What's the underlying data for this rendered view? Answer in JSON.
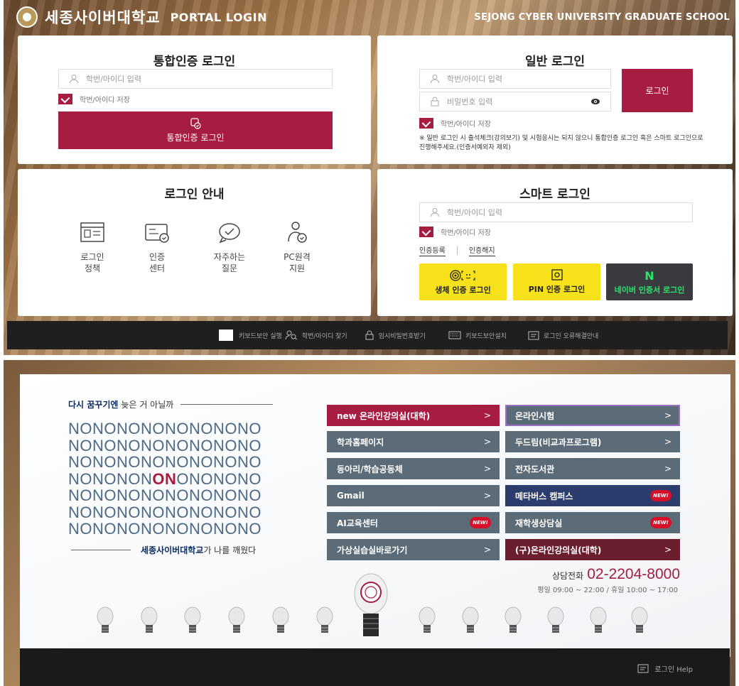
{
  "header": {
    "univ_name": "세종사이버대학교",
    "portal_label": "PORTAL LOGIN",
    "grad_school": "SEJONG CYBER UNIVERSITY GRADUATE SCHOOL"
  },
  "integrated_login": {
    "title": "통합인증 로그인",
    "id_placeholder": "학번/아이디 입력",
    "save_id": "학번/아이디 저장",
    "button": "통합인증 로그인"
  },
  "general_login": {
    "title": "일반 로그인",
    "id_placeholder": "학번/아이디 입력",
    "pw_placeholder": "비밀번호 입력",
    "button": "로그인",
    "save_id": "학번/아이디 저장",
    "notice": "※ 일반 로그인 시 출석체크(강의보기) 및 시험응시는 되지 않으니 통합인증 로그인 혹은 스마트 로그인으로 진행해주세요.(인증서예외자 제외)"
  },
  "login_guide": {
    "title": "로그인 안내",
    "items": [
      {
        "line1": "로그인",
        "line2": "정책"
      },
      {
        "line1": "인증",
        "line2": "센터"
      },
      {
        "line1": "자주하는",
        "line2": "질문"
      },
      {
        "line1": "PC원격",
        "line2": "지원"
      }
    ]
  },
  "smart_login": {
    "title": "스마트 로그인",
    "id_placeholder": "학번/아이디 입력",
    "save_id": "학번/아이디 저장",
    "register": "인증등록",
    "unregister": "인증해지",
    "bio_button": "생체 인증 로그인",
    "pin_button": "PIN 인증 로그인",
    "naver_button": "네이버 인증서 로그인",
    "naver_logo": "N"
  },
  "top_footer": {
    "keyboard_security_run": "키보드보안 실행",
    "find_id": "학번/아이디 찾기",
    "temp_password": "임시비밀번호받기",
    "keyboard_security_install": "키보드보안설치",
    "login_error_guide": "로그인 오류해결안내"
  },
  "promo": {
    "slogan_bold": "다시 꿈꾸기엔",
    "slogan_rest": "늦은 거 아닐까",
    "nono_rows": [
      "NONONONONONONONO",
      "NONONONONONONONO",
      "NONONONONONONONO",
      "NONONONONONONONO",
      "NONONONONONONONO",
      "NONONONONONONONO",
      "NONONONONONONONO"
    ],
    "row4_pre": "NONONON",
    "row4_on": "ON",
    "row4_post": "ONONONO",
    "slogan2_bold": "세종사이버대학교",
    "slogan2_rest": "가 나를 깨웠다"
  },
  "menu": {
    "left": [
      {
        "label": "new 온라인강의실(대학)",
        "arrow": ">"
      },
      {
        "label": "학과홈페이지",
        "arrow": ">"
      },
      {
        "label": "동아리/학습공동체",
        "arrow": ">"
      },
      {
        "label": "Gmail",
        "arrow": ">"
      },
      {
        "label": "AI교육센터",
        "badge": "NEW!"
      },
      {
        "label": "가상실습실바로가기",
        "arrow": ">"
      }
    ],
    "right": [
      {
        "label": "온라인시험",
        "arrow": ">"
      },
      {
        "label": "두드림(비교과프로그램)",
        "arrow": ">"
      },
      {
        "label": "전자도서관",
        "arrow": ">"
      },
      {
        "label": "메타버스 캠퍼스",
        "badge": "NEW!"
      },
      {
        "label": "재학생상담실",
        "badge": "NEW!"
      },
      {
        "label": "(구)온라인강의실(대학)",
        "arrow": ">"
      }
    ],
    "colors": {
      "red": "#a71d42",
      "gray": "#5c6b78",
      "navy": "#2c3c6c",
      "maroon": "#6b1f2e"
    }
  },
  "contact": {
    "label": "상담전화",
    "phone": "02-2204-8000",
    "hours": "평일 09:00 ~ 22:00 / 휴일 10:00 ~ 17:00"
  },
  "bottom_footer": {
    "help": "로그인 Help"
  }
}
